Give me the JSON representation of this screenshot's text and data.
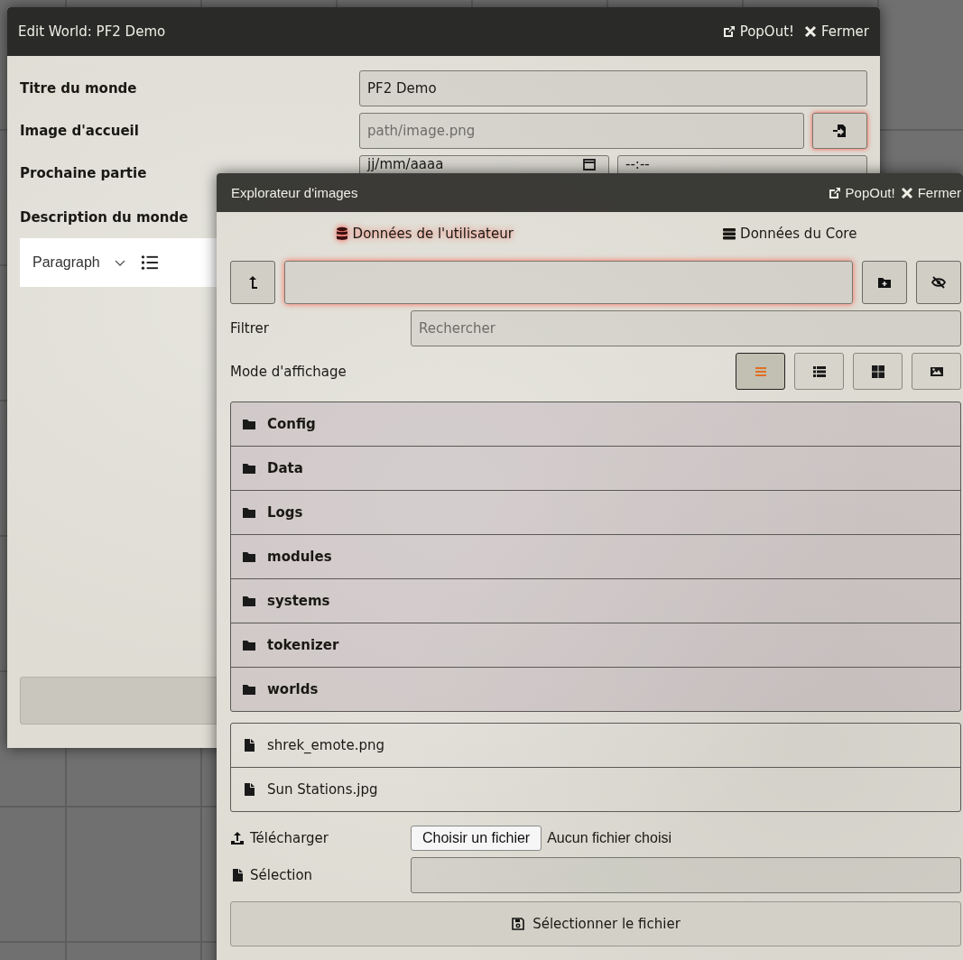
{
  "edit_world": {
    "title": "Edit World: PF2 Demo",
    "header_buttons": [
      {
        "kind": "popout",
        "label": "PopOut!"
      },
      {
        "kind": "close",
        "label": "Fermer"
      }
    ],
    "fields": [
      {
        "kind": "text",
        "label": "Titre du monde",
        "value": "PF2 Demo"
      },
      {
        "kind": "file",
        "label": "Image d'accueil",
        "placeholder": "path/image.png"
      },
      {
        "kind": "datetime",
        "label": "Prochaine partie",
        "date_placeholder": "jj/mm/aaaa",
        "time_placeholder": "--:--"
      }
    ],
    "description_label": "Description du monde",
    "editor": {
      "block_format": "Paragraph"
    }
  },
  "file_picker": {
    "title": "Explorateur d'images",
    "header_buttons": [
      {
        "kind": "popout",
        "label": "PopOut!"
      },
      {
        "kind": "close",
        "label": "Fermer"
      }
    ],
    "tabs": [
      {
        "kind": "database",
        "label": "Données de l'utilisateur",
        "selected": true
      },
      {
        "kind": "server",
        "label": "Données du Core",
        "selected": false
      }
    ],
    "filter": {
      "label": "Filtrer",
      "placeholder": "Rechercher"
    },
    "display_mode": {
      "label": "Mode d'affichage",
      "modes": [
        {
          "kind": "list",
          "selected": true
        },
        {
          "kind": "details",
          "selected": false
        },
        {
          "kind": "tiles",
          "selected": false
        },
        {
          "kind": "images",
          "selected": false
        }
      ]
    },
    "folders": [
      "Config",
      "Data",
      "Logs",
      "modules",
      "systems",
      "tokenizer",
      "worlds"
    ],
    "files": [
      "shrek_emote.png",
      "Sun Stations.jpg"
    ],
    "upload": {
      "label": "Télécharger",
      "button": "Choisir un fichier",
      "status": "Aucun fichier choisi"
    },
    "selection": {
      "label": "Sélection"
    },
    "select_button": "Sélectionner le fichier"
  }
}
